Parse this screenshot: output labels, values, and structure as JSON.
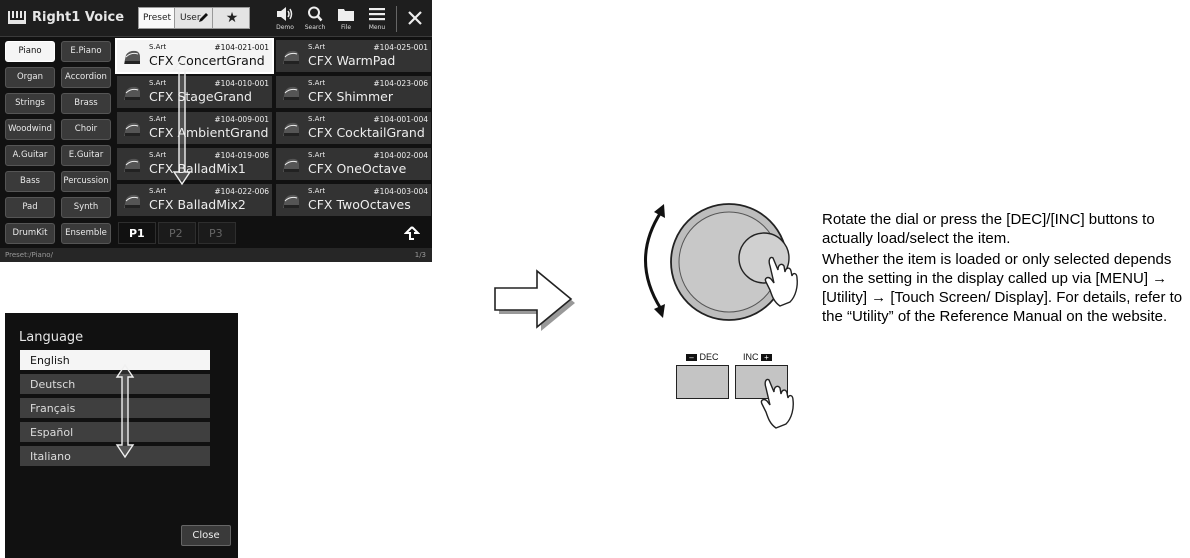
{
  "voice_screen": {
    "title": "Right1 Voice",
    "tabs": {
      "preset": "Preset",
      "user": "User",
      "favorite": "★"
    },
    "header_buttons": {
      "demo": "Demo",
      "search": "Search",
      "file": "File",
      "menu": "Menu"
    },
    "categories": [
      [
        "Piano",
        "E.Piano"
      ],
      [
        "Organ",
        "Accordion"
      ],
      [
        "Strings",
        "Brass"
      ],
      [
        "Woodwind",
        "Choir"
      ],
      [
        "A.Guitar",
        "E.Guitar"
      ],
      [
        "Bass",
        "Percussion"
      ],
      [
        "Pad",
        "Synth"
      ],
      [
        "DrumKit",
        "Ensemble"
      ]
    ],
    "selected_category": "Piano",
    "voices": [
      {
        "tag": "S.Art",
        "number": "#104-021-001",
        "name": "CFX ConcertGrand",
        "selected": true
      },
      {
        "tag": "S.Art",
        "number": "#104-025-001",
        "name": "CFX WarmPad"
      },
      {
        "tag": "S.Art",
        "number": "#104-010-001",
        "name": "CFX StageGrand"
      },
      {
        "tag": "S.Art",
        "number": "#104-023-006",
        "name": "CFX Shimmer"
      },
      {
        "tag": "S.Art",
        "number": "#104-009-001",
        "name": "CFX AmbientGrand"
      },
      {
        "tag": "S.Art",
        "number": "#104-001-004",
        "name": "CFX CocktailGrand"
      },
      {
        "tag": "S.Art",
        "number": "#104-019-006",
        "name": "CFX BalladMix1"
      },
      {
        "tag": "S.Art",
        "number": "#104-002-004",
        "name": "CFX OneOctave"
      },
      {
        "tag": "S.Art",
        "number": "#104-022-006",
        "name": "CFX BalladMix2"
      },
      {
        "tag": "S.Art",
        "number": "#104-003-004",
        "name": "CFX TwoOctaves"
      }
    ],
    "pages": [
      "P1",
      "P2",
      "P3"
    ],
    "active_page": "P1",
    "status_path": "Preset:/Piano/",
    "page_count": "1/3"
  },
  "language_screen": {
    "title": "Language",
    "items": [
      "English",
      "Deutsch",
      "Français",
      "Español",
      "Italiano"
    ],
    "selected": "English",
    "close_label": "Close"
  },
  "dial_buttons": {
    "dec_label": "DEC",
    "inc_label": "INC"
  },
  "instructions": {
    "line1": "Rotate the dial or press the [DEC]/[INC] buttons to actually load/select the item.",
    "line2": "Whether the item is loaded or only selected depends on the setting in the display called up via [MENU] → [Utility] → [Touch Screen/ Display]. For details, refer to the “Utility” of the Reference Manual on the website."
  }
}
